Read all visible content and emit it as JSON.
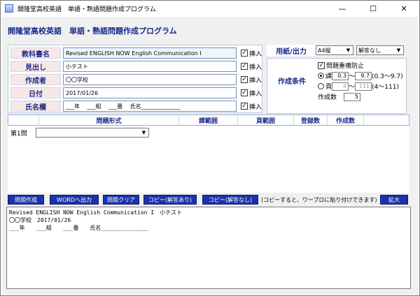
{
  "window": {
    "title": "開隆堂高校英語　単語・熟語問題作成プログラム",
    "controls": {
      "minimize": "—",
      "maximize": "☐",
      "close": "✕"
    }
  },
  "heading": "開隆堂高校英語　単語・熟語問題作成プログラム",
  "form": {
    "textbook": {
      "label": "教科書名",
      "value": "Revised ENGLISH NOW English Communication I",
      "insert": "挿入"
    },
    "title": {
      "label": "見出し",
      "value": "小テスト",
      "insert": "挿入"
    },
    "author": {
      "label": "作成者",
      "value": "〇〇学校",
      "insert": "挿入"
    },
    "date": {
      "label": "日付",
      "value": "2017/01/26",
      "insert": "挿入"
    },
    "name_field": {
      "label": "氏名欄",
      "value": "___年　 ___組　 ___番　 氏名______________",
      "insert": "挿入"
    }
  },
  "paper": {
    "label": "用紙/出力",
    "size": "A4縦",
    "answer": "解答なし"
  },
  "conditions": {
    "label": "作成条件",
    "no_duplicate": "問題重複防止",
    "lesson_prefix": "課",
    "lesson_from": "0.3",
    "lesson_sep": "～",
    "lesson_to": "9.7",
    "lesson_range": "(0.3～9.7)",
    "page_prefix": "頁",
    "page_from": "4",
    "page_sep": "～",
    "page_to": "111",
    "page_range": "(4～111)",
    "count_label": "作成数",
    "count": "5"
  },
  "grid": {
    "headers": [
      "問題形式",
      "課範囲",
      "頁範囲",
      "登録数",
      "作成数"
    ],
    "row_label": "第1問",
    "row_value": ""
  },
  "buttons": {
    "create": "問題作成",
    "word": "WORDへ出力",
    "clear": "問題クリア",
    "copy_with": "コピー(解答あり)",
    "copy_without": "コピー(解答なし)",
    "hint": "(コピーすると、ワープロに貼り付けできます)",
    "zoom": "拡大"
  },
  "preview": {
    "line1": "Revised ENGLISH NOW English Communication I　小テスト",
    "line2": "〇〇学校　2017/01/26",
    "line3": "",
    "line4": "___年　　___組　　___番　　氏名______________"
  },
  "colors": {
    "accent": "#1a2a8a",
    "button_blue": "#1c33a8",
    "label_bg": "#f7e7e7",
    "panel_bg": "#f0f0f0"
  }
}
